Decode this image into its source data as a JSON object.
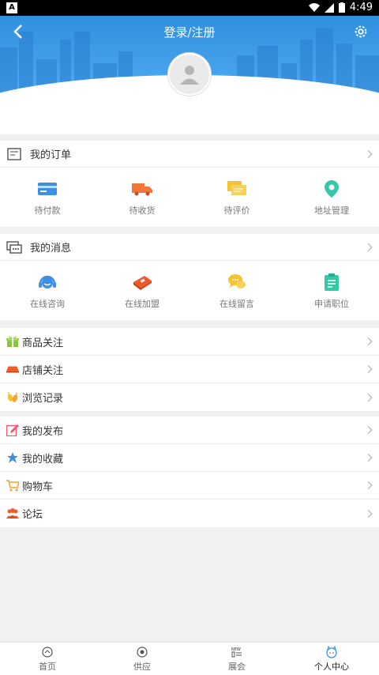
{
  "status_bar": {
    "time": "4:49"
  },
  "header": {
    "title": "登录/注册"
  },
  "orders": {
    "title": "我的订单",
    "items": [
      {
        "label": "待付款",
        "icon": "card-icon",
        "color": "#3d8ee6"
      },
      {
        "label": "待收货",
        "icon": "truck-icon",
        "color": "#f2763a"
      },
      {
        "label": "待评价",
        "icon": "comment-icon",
        "color": "#f4c233"
      },
      {
        "label": "地址管理",
        "icon": "location-pin-icon",
        "color": "#35c7a8"
      }
    ]
  },
  "messages": {
    "title": "我的消息",
    "items": [
      {
        "label": "在线咨询",
        "icon": "headset-icon",
        "color": "#3d8ee6"
      },
      {
        "label": "在线加盟",
        "icon": "book-icon",
        "color": "#f05a2a"
      },
      {
        "label": "在线留言",
        "icon": "chat-bubbles-icon",
        "color": "#f4c233"
      },
      {
        "label": "申请职位",
        "icon": "clipboard-icon",
        "color": "#35c7a8"
      }
    ]
  },
  "list1": [
    {
      "label": "商品关注",
      "icon": "gift-icon",
      "color": "#8ac43f"
    },
    {
      "label": "店铺关注",
      "icon": "store-icon",
      "color": "#f05a2a"
    },
    {
      "label": "浏览记录",
      "icon": "footprint-icon",
      "color": "#f4c233"
    }
  ],
  "list2": [
    {
      "label": "我的发布",
      "icon": "edit-icon",
      "color": "#f05a6a"
    },
    {
      "label": "我的收藏",
      "icon": "star-icon",
      "color": "#3d8ee6"
    },
    {
      "label": "购物车",
      "icon": "cart-icon",
      "color": "#f4a233"
    },
    {
      "label": "论坛",
      "icon": "people-icon",
      "color": "#f05a2a"
    }
  ],
  "tabs": [
    {
      "label": "首页",
      "icon": "home-icon"
    },
    {
      "label": "供应",
      "icon": "supply-icon"
    },
    {
      "label": "展会",
      "icon": "new-badge-icon"
    },
    {
      "label": "个人中心",
      "icon": "user-center-icon",
      "active": true
    }
  ]
}
